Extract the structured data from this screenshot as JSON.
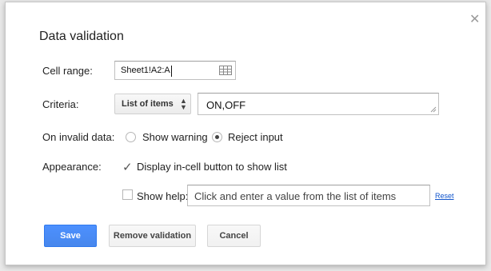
{
  "dialog": {
    "title": "Data validation",
    "close_icon": "close-icon"
  },
  "cell_range": {
    "label": "Cell range:",
    "value": "Sheet1!A2:A",
    "icon": "grid-icon"
  },
  "criteria": {
    "label": "Criteria:",
    "type_selected": "List of items",
    "type_arrow_icon": "up-down-arrows-icon",
    "value": "ON,OFF"
  },
  "invalid_data": {
    "label": "On invalid data:",
    "options": [
      {
        "label": "Show warning",
        "selected": false
      },
      {
        "label": "Reject input",
        "selected": true
      }
    ]
  },
  "appearance": {
    "label": "Appearance:",
    "display_button": {
      "label": "Display in-cell button to show list",
      "checked": true
    },
    "show_help": {
      "label": "Show help:",
      "checked": false
    },
    "help_text": "Click and enter a value from the list of items",
    "reset_label": "Reset"
  },
  "buttons": {
    "save": "Save",
    "remove": "Remove validation",
    "cancel": "Cancel"
  },
  "colors": {
    "primary": "#4d90fe",
    "link": "#1155cc"
  }
}
